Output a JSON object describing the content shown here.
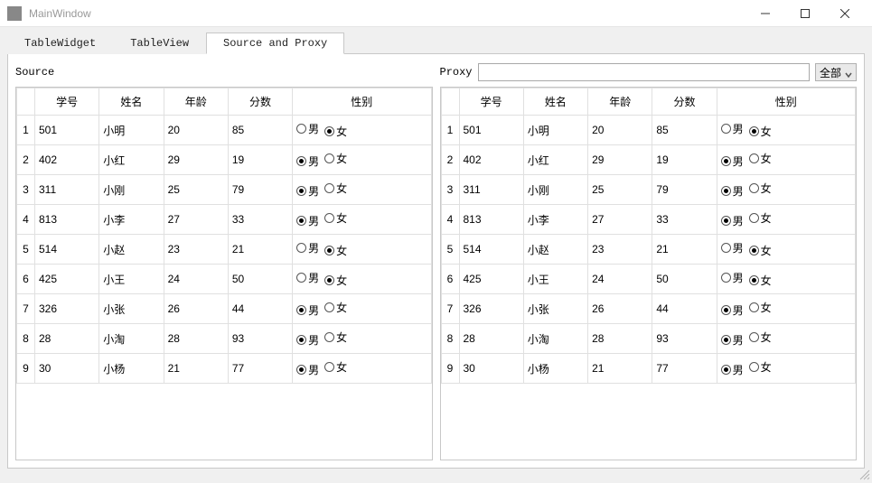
{
  "window": {
    "title": "MainWindow"
  },
  "tabs": [
    {
      "label": "TableWidget"
    },
    {
      "label": "TableView"
    },
    {
      "label": "Source and Proxy"
    }
  ],
  "activeTab": 2,
  "source": {
    "label": "Source"
  },
  "proxy": {
    "label": "Proxy",
    "filterValue": "",
    "comboValue": "全部"
  },
  "columns": {
    "id": "学号",
    "name": "姓名",
    "age": "年龄",
    "score": "分数",
    "gender": "性别"
  },
  "genderLabels": {
    "male": "男",
    "female": "女"
  },
  "rows": [
    {
      "idx": "1",
      "id": "501",
      "name": "小明",
      "age": "20",
      "score": "85",
      "gender": "female"
    },
    {
      "idx": "2",
      "id": "402",
      "name": "小红",
      "age": "29",
      "score": "19",
      "gender": "male"
    },
    {
      "idx": "3",
      "id": "311",
      "name": "小刚",
      "age": "25",
      "score": "79",
      "gender": "male"
    },
    {
      "idx": "4",
      "id": "813",
      "name": "小李",
      "age": "27",
      "score": "33",
      "gender": "male"
    },
    {
      "idx": "5",
      "id": "514",
      "name": "小赵",
      "age": "23",
      "score": "21",
      "gender": "female"
    },
    {
      "idx": "6",
      "id": "425",
      "name": "小王",
      "age": "24",
      "score": "50",
      "gender": "female"
    },
    {
      "idx": "7",
      "id": "326",
      "name": "小张",
      "age": "26",
      "score": "44",
      "gender": "male"
    },
    {
      "idx": "8",
      "id": "28",
      "name": "小淘",
      "age": "28",
      "score": "93",
      "gender": "male"
    },
    {
      "idx": "9",
      "id": "30",
      "name": "小杨",
      "age": "21",
      "score": "77",
      "gender": "male"
    }
  ]
}
